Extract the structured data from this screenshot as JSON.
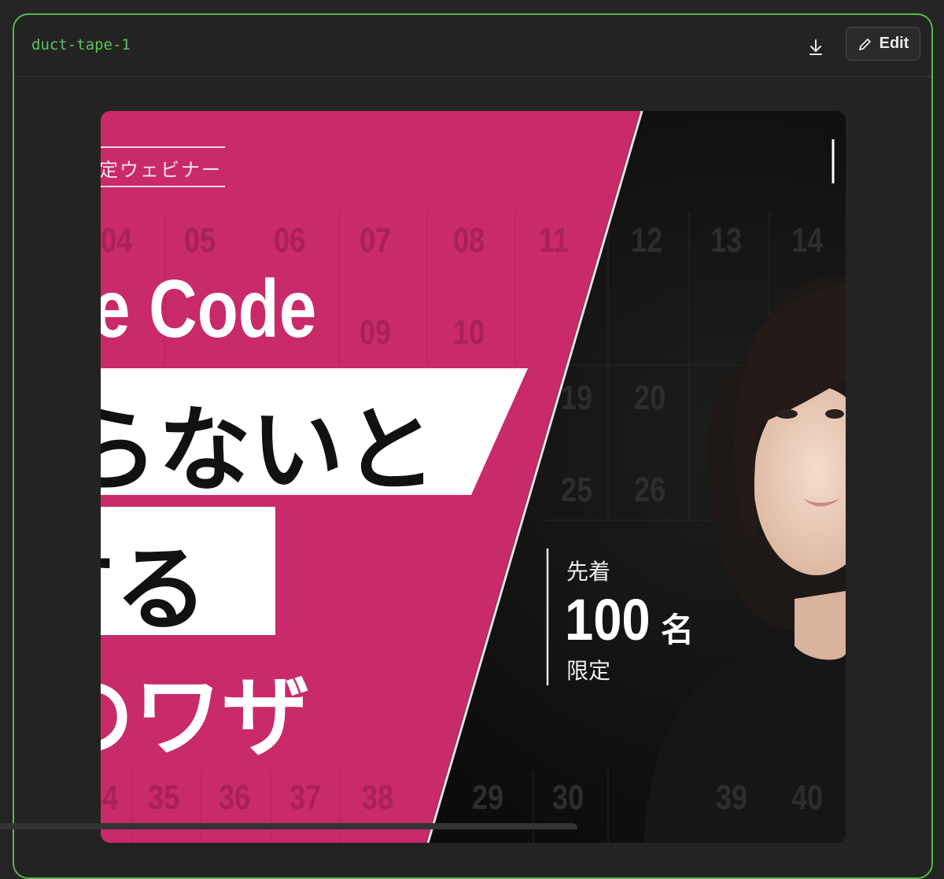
{
  "header": {
    "file_name": "duct-tape-1",
    "edit_label": "Edit"
  },
  "banner": {
    "badge": "定ウェビナー",
    "title_line1": "e Code",
    "title_line2": "らないと",
    "title_line3": "する",
    "title_line4": "のワザ",
    "limit_top": "先着",
    "limit_number": "100",
    "limit_unit": "名",
    "limit_bottom": "限定",
    "calendar_row1": [
      "04",
      "05",
      "06",
      "07",
      "08",
      "11",
      "12",
      "13",
      "14"
    ],
    "calendar_row2": [
      "09",
      "10"
    ],
    "calendar_row3": [
      "19",
      "20"
    ],
    "calendar_row4": [
      "25",
      "26"
    ],
    "calendar_row5": [
      "34",
      "35",
      "36",
      "37",
      "38",
      "29",
      "30",
      "39",
      "40"
    ]
  },
  "colors": {
    "accent_pink": "#c92a69",
    "dark": "#111111",
    "brand_green": "#58b74c"
  }
}
